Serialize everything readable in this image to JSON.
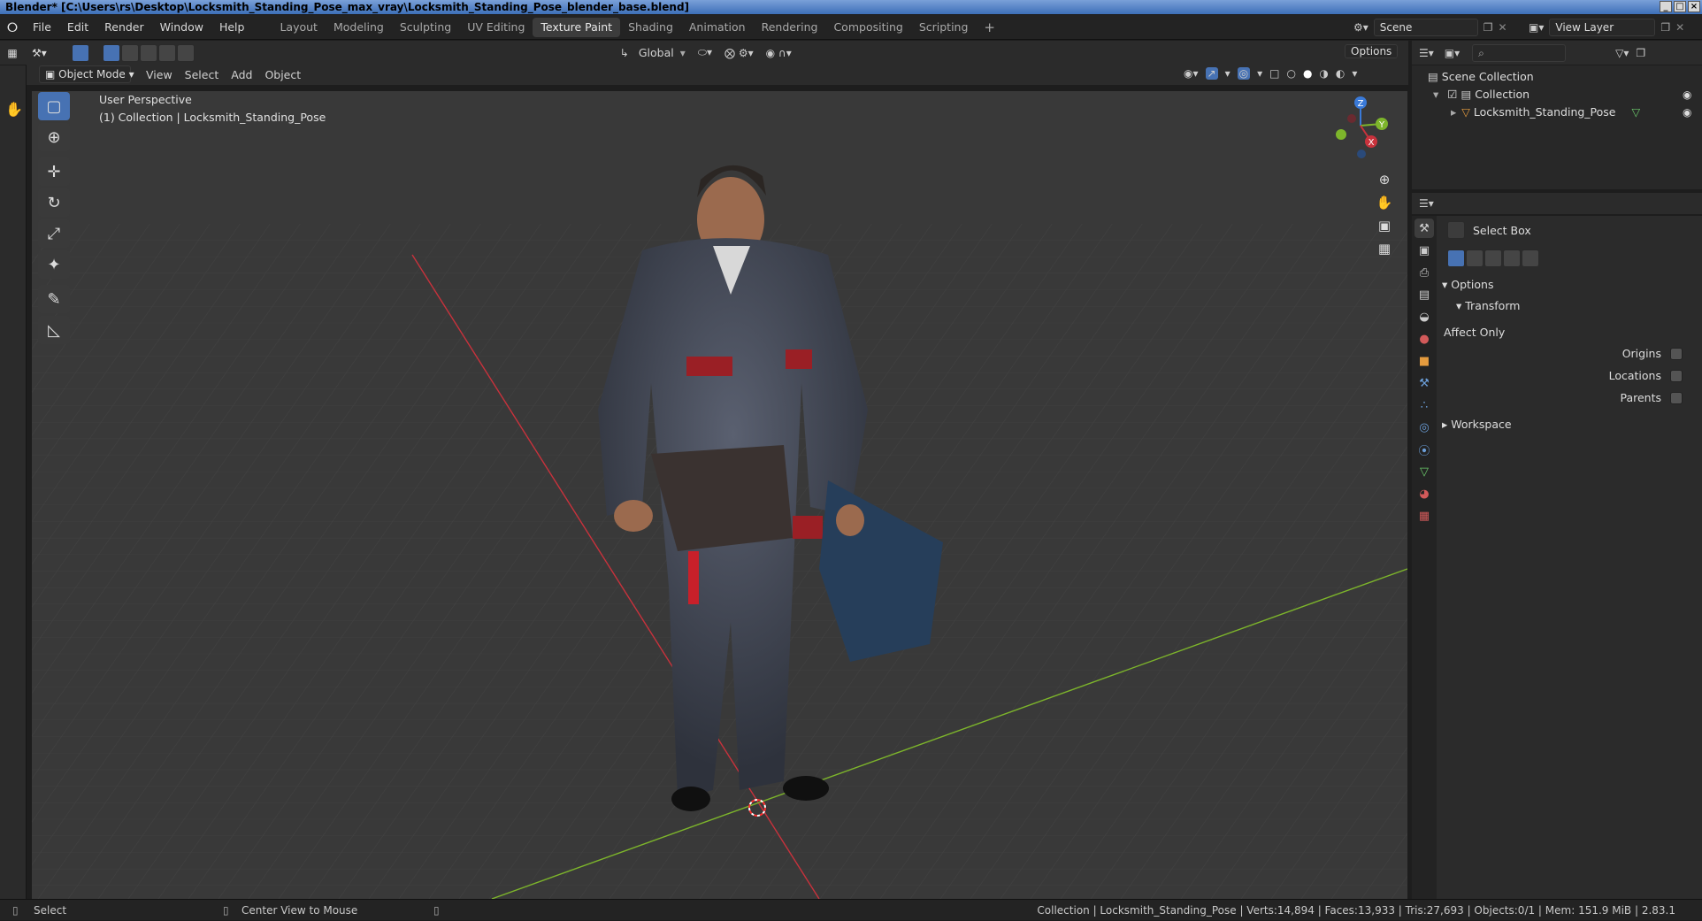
{
  "window": {
    "title": "Blender* [C:\\Users\\rs\\Desktop\\Locksmith_Standing_Pose_max_vray\\Locksmith_Standing_Pose_blender_base.blend]",
    "buttons": [
      "_",
      "□",
      "×"
    ]
  },
  "topbar": {
    "menus": [
      "File",
      "Edit",
      "Render",
      "Window",
      "Help"
    ],
    "workspaces": [
      "Layout",
      "Modeling",
      "Sculpting",
      "UV Editing",
      "Texture Paint",
      "Shading",
      "Animation",
      "Rendering",
      "Compositing",
      "Scripting"
    ],
    "active_workspace": "Texture Paint",
    "add_symbol": "+",
    "scene": "Scene",
    "view_layer": "View Layer"
  },
  "toolbar": {
    "transform_orientation": "Global",
    "options_label": "Options"
  },
  "header": {
    "mode": "Object Mode",
    "menus": [
      "View",
      "Select",
      "Add",
      "Object"
    ]
  },
  "viewport": {
    "perspective": "User Perspective",
    "collection_info": "(1) Collection | Locksmith_Standing_Pose",
    "gizmo": {
      "x": "X",
      "y": "Y",
      "z": "Z"
    }
  },
  "outliner": {
    "search_placeholder": "",
    "scene_collection": "Scene Collection",
    "collection": "Collection",
    "object": "Locksmith_Standing_Pose"
  },
  "properties": {
    "tool_name": "Select Box",
    "options_label": "Options",
    "transform_label": "Transform",
    "affect_only": "Affect Only",
    "origins": "Origins",
    "locations": "Locations",
    "parents": "Parents",
    "workspace": "Workspace"
  },
  "statusbar": {
    "left": "Select",
    "middle": "Center View to Mouse",
    "right": "Collection | Locksmith_Standing_Pose | Verts:14,894 | Faces:13,933 | Tris:27,693 | Objects:0/1 | Mem: 151.9 MiB | 2.83.1"
  },
  "colors": {
    "accent": "#4772b3",
    "viewport_bg": "#393939",
    "x_axis": "#c8323c",
    "y_axis": "#7db52b",
    "z_axis": "#3a7ad8"
  }
}
